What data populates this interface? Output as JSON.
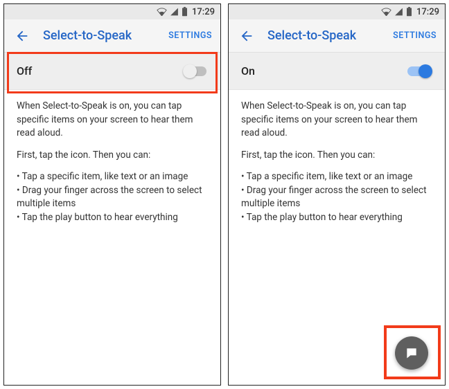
{
  "status": {
    "time": "17:29"
  },
  "left": {
    "header": {
      "title": "Select-to-Speak",
      "settings": "SETTINGS"
    },
    "toggle": {
      "label": "Off",
      "on": false
    },
    "desc": {
      "p1": "When Select-to-Speak is on, you can tap specific items on your screen to hear them read aloud.",
      "p2": "First, tap the icon. Then you can:",
      "b1": "Tap a specific item, like text or an image",
      "b2": "Drag your finger across the screen to select multiple items",
      "b3": "Tap the play button to hear everything"
    }
  },
  "right": {
    "header": {
      "title": "Select-to-Speak",
      "settings": "SETTINGS"
    },
    "toggle": {
      "label": "On",
      "on": true
    },
    "desc": {
      "p1": "When Select-to-Speak is on, you can tap specific items on your screen to hear them read aloud.",
      "p2": "First, tap the icon. Then you can:",
      "b1": "Tap a specific item, like text or an image",
      "b2": "Drag your finger across the screen to select multiple items",
      "b3": "Tap the play button to hear everything"
    }
  }
}
